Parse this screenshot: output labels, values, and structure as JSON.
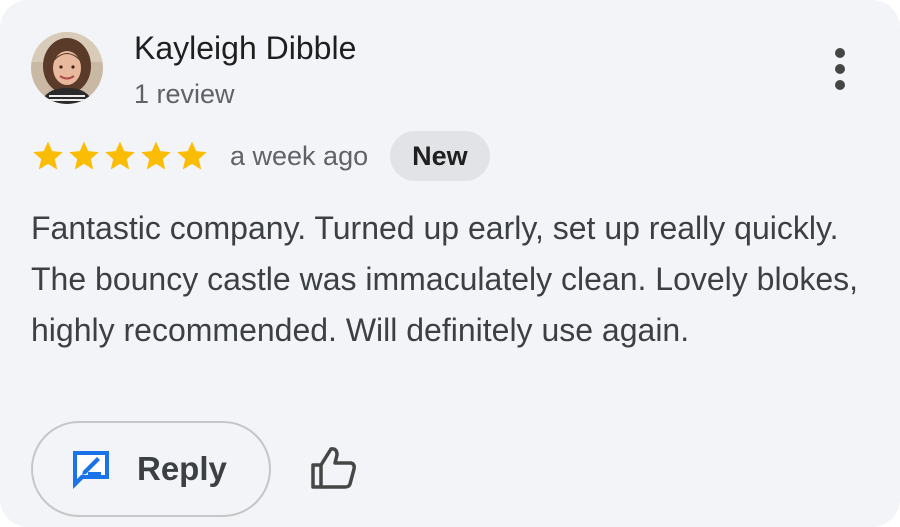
{
  "review": {
    "author": {
      "name": "Kayleigh Dibble",
      "review_count": "1 review",
      "avatar_icon": "user-photo"
    },
    "rating": {
      "stars": 5,
      "max_stars": 5,
      "star_color": "#fbbc04"
    },
    "time_ago": "a week ago",
    "badge": "New",
    "text": "Fantastic company. Turned up early, set up really quickly. The bouncy castle was immaculately clean. Lovely blokes, highly recommended. Will definitely use again."
  },
  "actions": {
    "reply_label": "Reply",
    "reply_icon": "reply-edit-icon",
    "like_icon": "thumb-up-icon",
    "more_icon": "more-vert-icon"
  },
  "colors": {
    "card_background": "#f3f4f8",
    "accent_blue": "#1a73e8",
    "badge_background": "#e1e3e7"
  }
}
